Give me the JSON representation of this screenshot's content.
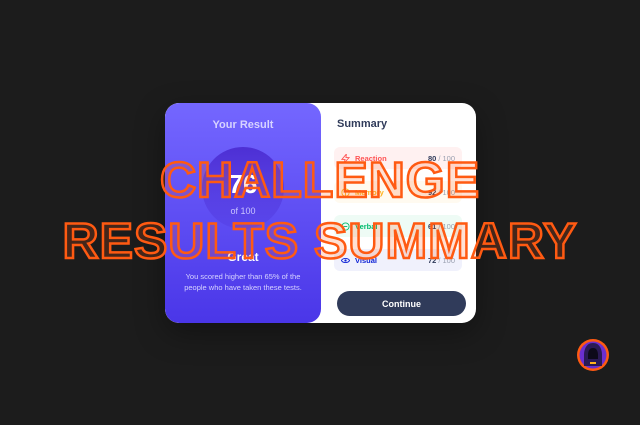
{
  "result_panel": {
    "heading": "Your Result",
    "score": "76",
    "out_of": "of 100",
    "grade": "Great",
    "description": "You scored higher than 65% of the people who have taken these tests."
  },
  "summary_panel": {
    "title": "Summary",
    "items": [
      {
        "label": "Reaction",
        "score": "80",
        "max": "/ 100",
        "icon": "lightning-icon",
        "color": "#ff5555",
        "bg": "#fff1f1"
      },
      {
        "label": "Memory",
        "score": "92",
        "max": "/ 100",
        "icon": "brain-icon",
        "color": "#ffb21e",
        "bg": "#fffaf0"
      },
      {
        "label": "Verbal",
        "score": "61",
        "max": "/ 100",
        "icon": "chat-icon",
        "color": "#00bb6d",
        "bg": "#eefbf5"
      },
      {
        "label": "Visual",
        "score": "72",
        "max": "/ 100",
        "icon": "eye-icon",
        "color": "#1125d6",
        "bg": "#f0f1fc"
      }
    ],
    "continue_label": "Continue"
  },
  "overlay": {
    "line1": "CHALLENGE",
    "line2": "RESULTS SUMMARY"
  },
  "colors": {
    "accent": "#ff5a12",
    "result_gradient_top": "#7467ff",
    "result_gradient_bottom": "#4a36e8",
    "button": "#303b5a"
  }
}
